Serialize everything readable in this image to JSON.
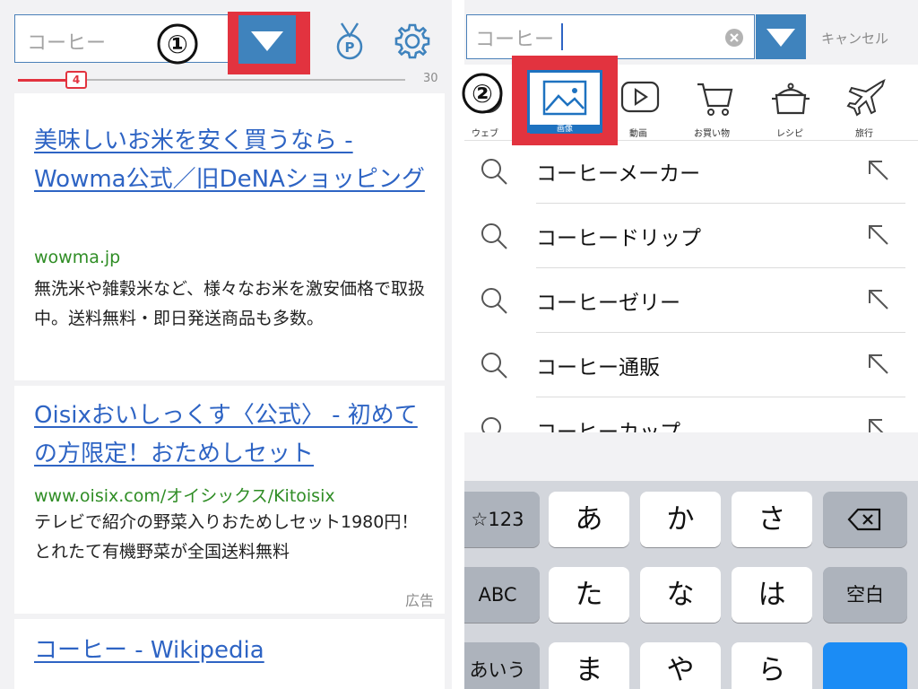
{
  "left": {
    "search_value": "コーヒー",
    "annotation_number": "①",
    "slider": {
      "value_label": "4",
      "max_label": "30",
      "value": 4,
      "max": 30
    },
    "results": [
      {
        "title": "美味しいお米を安く買うなら - Wowma公式／旧DeNAショッピング",
        "url": "wowma.jp",
        "description": "無洗米や雑穀米など、様々なお米を激安価格で取扱中。送料無料・即日発送商品も多数。"
      },
      {
        "title": "Oisixおいしっくす〈公式〉 - 初めての方限定！おためしセット",
        "url": "www.oisix.com/オイシックス/Kitoisix",
        "description": "テレビで紹介の野菜入りおためしセット1980円！とれたて有機野菜が全国送料無料",
        "ad_label": "広告"
      },
      {
        "title": "コーヒー - Wikipedia"
      }
    ]
  },
  "right": {
    "search_value": "コーヒー",
    "cancel_label": "キャンセル",
    "annotation_number": "②",
    "categories": [
      {
        "label": "ウェブ",
        "icon": "web-icon"
      },
      {
        "label": "画像",
        "icon": "image-icon",
        "selected": true
      },
      {
        "label": "動画",
        "icon": "video-play-icon"
      },
      {
        "label": "お買い物",
        "icon": "shopping-cart-icon"
      },
      {
        "label": "レシピ",
        "icon": "cooking-pot-icon"
      },
      {
        "label": "旅行",
        "icon": "airplane-icon"
      }
    ],
    "suggestions": [
      "コーヒーメーカー",
      "コーヒードリップ",
      "コーヒーゼリー",
      "コーヒー通販",
      "コーヒーカップ"
    ],
    "keyboard": {
      "row1": [
        "☆123",
        "あ",
        "か",
        "さ",
        ""
      ],
      "row2": [
        "ABC",
        "た",
        "な",
        "は",
        "空白"
      ],
      "row3": [
        "あいう",
        "ま",
        "や",
        "ら",
        ""
      ]
    }
  },
  "colors": {
    "accent_blue": "#3f83bd",
    "highlight_red": "#e2333f",
    "link_blue": "#2e64c4",
    "url_green": "#2f8d25"
  }
}
